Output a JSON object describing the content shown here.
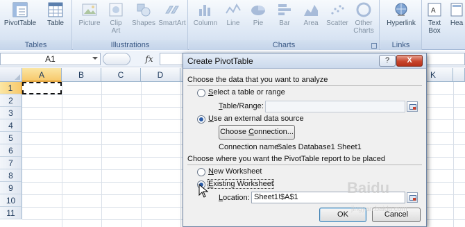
{
  "ribbon": {
    "groups": [
      {
        "label": "Tables",
        "buttons": [
          "PivotTable",
          "Table"
        ]
      },
      {
        "label": "Illustrations",
        "buttons": [
          "Picture",
          "Clip Art",
          "Shapes",
          "SmartArt"
        ]
      },
      {
        "label": "Charts",
        "buttons": [
          "Column",
          "Line",
          "Pie",
          "Bar",
          "Area",
          "Scatter",
          "Other Charts"
        ]
      },
      {
        "label": "Links",
        "buttons": [
          "Hyperlink"
        ]
      },
      {
        "label": "",
        "buttons": [
          "Text Box",
          "Hea"
        ]
      }
    ]
  },
  "formula_bar": {
    "name_box": "A1",
    "fx": "fx",
    "value": ""
  },
  "grid": {
    "columns": [
      "A",
      "B",
      "C",
      "D",
      "K"
    ],
    "rows": [
      "1",
      "2",
      "3",
      "4",
      "5",
      "6",
      "7",
      "8",
      "9",
      "10",
      "11"
    ],
    "selected_cell": "A1"
  },
  "dialog": {
    "title": "Create PivotTable",
    "help_glyph": "?",
    "close_glyph": "X",
    "section1_label": "Choose the data that you want to analyze",
    "opt_select_table": {
      "prefix": "",
      "key": "S",
      "rest": "elect a table or range"
    },
    "table_range_label": {
      "prefix": "",
      "key": "T",
      "rest": "able/Range:"
    },
    "table_range_value": "",
    "opt_external": {
      "prefix": "",
      "key": "U",
      "rest": "se an external data source"
    },
    "choose_connection": {
      "prefix": "Choose ",
      "key": "C",
      "rest": "onnection..."
    },
    "connection_name_label": "Connection name:",
    "connection_name_value": "Sales Database1 Sheet1",
    "section2_label": "Choose where you want the PivotTable report to be placed",
    "opt_new_ws": {
      "prefix": "",
      "key": "N",
      "rest": "ew Worksheet"
    },
    "opt_existing_ws": {
      "prefix": "",
      "key": "E",
      "rest": "xisting Worksheet"
    },
    "location_label": {
      "prefix": "",
      "key": "L",
      "rest": "ocation:"
    },
    "location_value": "Sheet1!$A$1",
    "ok_label": "OK",
    "cancel_label": "Cancel"
  },
  "watermark": {
    "main": "Baidu",
    "sub": "jingyan.baidu.com"
  },
  "colors": {
    "ribbon_label": "#3b5a86",
    "selected_header": "#f7c96c",
    "close_button": "#c8462e",
    "radio_dot": "#2c5da8"
  }
}
